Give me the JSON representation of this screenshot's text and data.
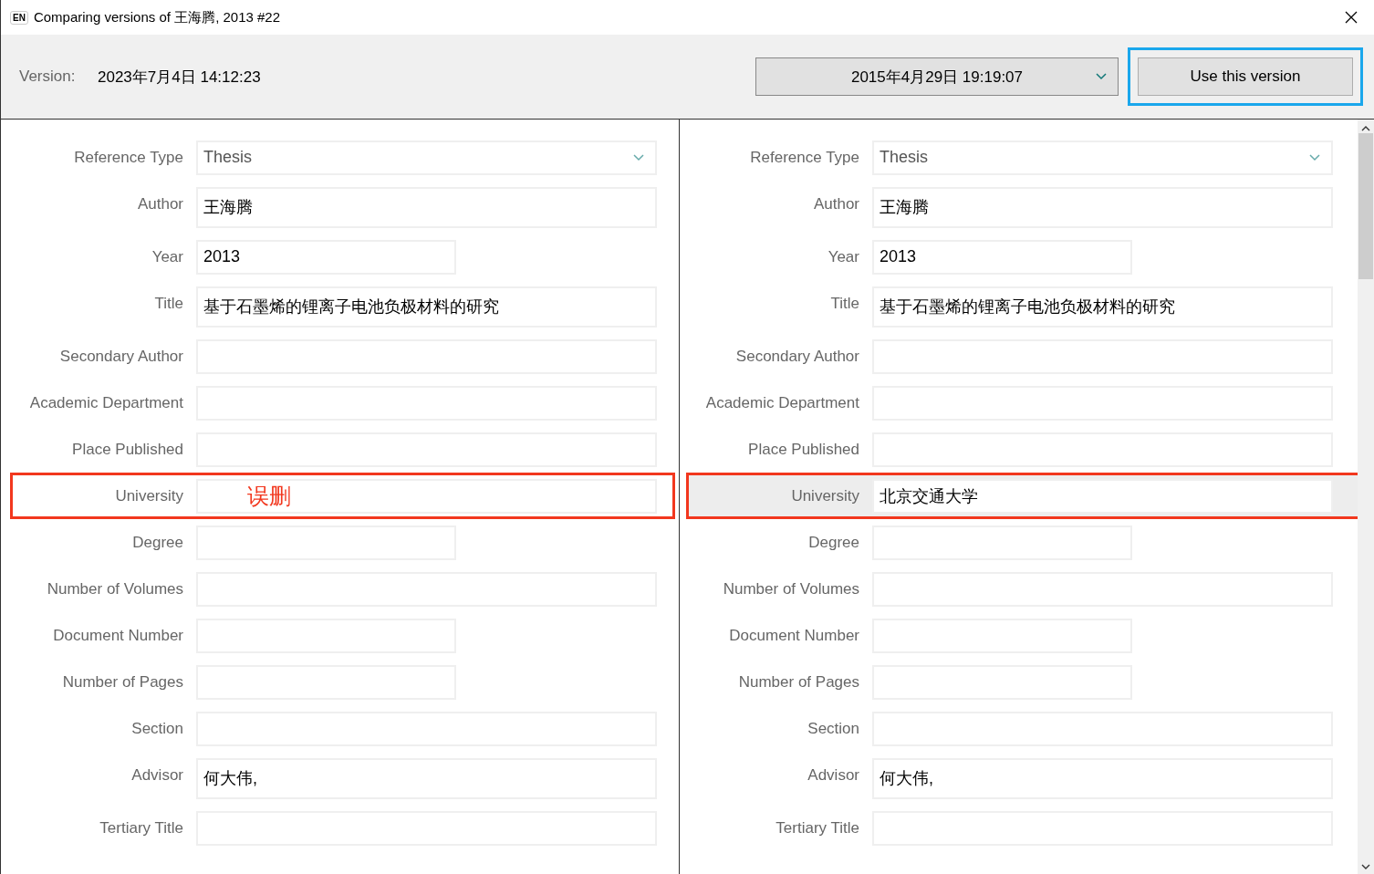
{
  "window": {
    "app_badge": "EN",
    "title": "Comparing versions of 王海腾, 2013 #22"
  },
  "header": {
    "version_label": "Version:",
    "version_value": "2023年7月4日 14:12:23",
    "compare_dropdown": "2015年4月29日 19:19:07",
    "use_button": {
      "label": "Use this version",
      "focused": true
    }
  },
  "panels": [
    {
      "fields": [
        {
          "label": "Reference Type",
          "value": "Thesis",
          "kind": "dropdown",
          "short": false,
          "multiline": false,
          "marked": false,
          "highlighted": false
        },
        {
          "label": "Author",
          "value": "王海腾",
          "kind": "text",
          "short": false,
          "multiline": true,
          "marked": false,
          "highlighted": false
        },
        {
          "label": "Year",
          "value": "2013",
          "kind": "text",
          "short": true,
          "multiline": false,
          "marked": false,
          "highlighted": false
        },
        {
          "label": "Title",
          "value": "基于石墨烯的锂离子电池负极材料的研究",
          "kind": "text",
          "short": false,
          "multiline": true,
          "marked": false,
          "highlighted": false
        },
        {
          "label": "Secondary Author",
          "kind": "text",
          "short": false,
          "multiline": false,
          "marked": false,
          "highlighted": false
        },
        {
          "label": "Academic Department",
          "kind": "text",
          "short": false,
          "multiline": false,
          "marked": false,
          "highlighted": false
        },
        {
          "label": "Place Published",
          "kind": "text",
          "short": false,
          "multiline": false,
          "marked": false,
          "highlighted": false
        },
        {
          "label": "University",
          "annotation": "误删",
          "kind": "text",
          "short": false,
          "multiline": false,
          "marked": true,
          "highlighted": false
        },
        {
          "label": "Degree",
          "kind": "text",
          "short": true,
          "multiline": false,
          "marked": false,
          "highlighted": false
        },
        {
          "label": "Number of Volumes",
          "kind": "text",
          "short": false,
          "multiline": false,
          "marked": false,
          "highlighted": false
        },
        {
          "label": "Document Number",
          "kind": "text",
          "short": true,
          "multiline": false,
          "marked": false,
          "highlighted": false
        },
        {
          "label": "Number of Pages",
          "kind": "text",
          "short": true,
          "multiline": false,
          "marked": false,
          "highlighted": false
        },
        {
          "label": "Section",
          "kind": "text",
          "short": false,
          "multiline": false,
          "marked": false,
          "highlighted": false
        },
        {
          "label": "Advisor",
          "value": "何大伟,",
          "kind": "text",
          "short": false,
          "multiline": true,
          "marked": false,
          "highlighted": false
        },
        {
          "label": "Tertiary Title",
          "kind": "text",
          "short": false,
          "multiline": false,
          "marked": false,
          "highlighted": false
        }
      ]
    },
    {
      "fields": [
        {
          "label": "Reference Type",
          "value": "Thesis",
          "kind": "dropdown",
          "short": false,
          "multiline": false,
          "marked": false,
          "highlighted": false
        },
        {
          "label": "Author",
          "value": "王海腾",
          "kind": "text",
          "short": false,
          "multiline": true,
          "marked": false,
          "highlighted": false
        },
        {
          "label": "Year",
          "value": "2013",
          "kind": "text",
          "short": true,
          "multiline": false,
          "marked": false,
          "highlighted": false
        },
        {
          "label": "Title",
          "value": "基于石墨烯的锂离子电池负极材料的研究",
          "kind": "text",
          "short": false,
          "multiline": true,
          "marked": false,
          "highlighted": false
        },
        {
          "label": "Secondary Author",
          "kind": "text",
          "short": false,
          "multiline": false,
          "marked": false,
          "highlighted": false
        },
        {
          "label": "Academic Department",
          "kind": "text",
          "short": false,
          "multiline": false,
          "marked": false,
          "highlighted": false
        },
        {
          "label": "Place Published",
          "kind": "text",
          "short": false,
          "multiline": false,
          "marked": false,
          "highlighted": false
        },
        {
          "label": "University",
          "value": "北京交通大学",
          "kind": "text",
          "short": false,
          "multiline": false,
          "marked": true,
          "highlighted": true
        },
        {
          "label": "Degree",
          "kind": "text",
          "short": true,
          "multiline": false,
          "marked": false,
          "highlighted": false
        },
        {
          "label": "Number of Volumes",
          "kind": "text",
          "short": false,
          "multiline": false,
          "marked": false,
          "highlighted": false
        },
        {
          "label": "Document Number",
          "kind": "text",
          "short": true,
          "multiline": false,
          "marked": false,
          "highlighted": false
        },
        {
          "label": "Number of Pages",
          "kind": "text",
          "short": true,
          "multiline": false,
          "marked": false,
          "highlighted": false
        },
        {
          "label": "Section",
          "kind": "text",
          "short": false,
          "multiline": false,
          "marked": false,
          "highlighted": false
        },
        {
          "label": "Advisor",
          "value": "何大伟,",
          "kind": "text",
          "short": false,
          "multiline": true,
          "marked": false,
          "highlighted": false
        },
        {
          "label": "Tertiary Title",
          "kind": "text",
          "short": false,
          "multiline": false,
          "marked": false,
          "highlighted": false
        }
      ]
    }
  ]
}
